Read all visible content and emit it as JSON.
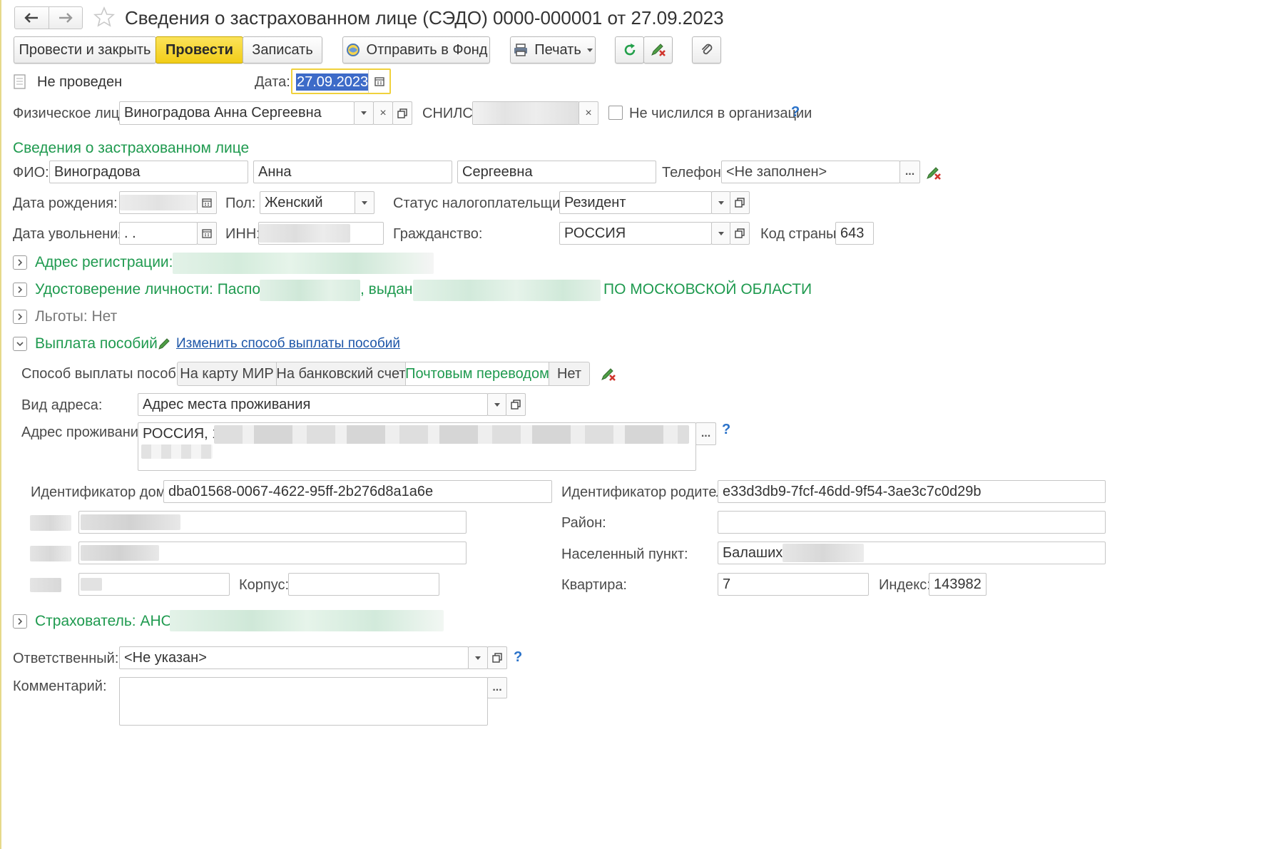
{
  "window": {
    "title": "Сведения о застрахованном лице (СЭДО) 0000-000001 от 27.09.2023"
  },
  "toolbar": {
    "post_and_close": "Провести и закрыть",
    "post": "Провести",
    "save": "Записать",
    "send_to_fund": "Отправить в Фонд",
    "print": "Печать"
  },
  "status": {
    "state": "Не проведен",
    "date_label": "Дата:",
    "date_value": "27.09.2023"
  },
  "person": {
    "label": "Физическое лицо:",
    "value": "Виноградова Анна Сергеевна",
    "snils_label": "СНИЛС:",
    "not_listed_label": "Не числился в организации",
    "help": "?"
  },
  "insured": {
    "section_title": "Сведения о застрахованном лице",
    "fio_label": "ФИО:",
    "last_name": "Виноградова",
    "first_name": "Анна",
    "middle_name": "Сергеевна",
    "phone_label": "Телефон:",
    "phone_value": "<Не заполнен>",
    "ellipsis": "...",
    "birth_label": "Дата рождения:",
    "sex_label": "Пол:",
    "sex_value": "Женский",
    "tax_status_label": "Статус налогоплательщика:",
    "tax_status_value": "Резидент",
    "dismissal_label": "Дата увольнения:",
    "dismissal_value": " .  .",
    "inn_label": "ИНН:",
    "citizenship_label": "Гражданство:",
    "citizenship_value": "РОССИЯ",
    "country_code_label": "Код страны:",
    "country_code_value": "643"
  },
  "groups": {
    "registration": "Адрес регистрации: Е",
    "identity_prefix": "Удостоверение личности: Паспорт",
    "identity_issued": ", выдан",
    "identity_suffix": "ПО МОСКОВСКОЙ ОБЛАСТИ",
    "benefits_privileges": "Льготы: Нет",
    "payment": "Выплата пособий",
    "change_payment_link": "Изменить способ выплаты пособий",
    "insurer": "Страхователь: АНО ("
  },
  "payment": {
    "method_label": "Способ выплаты пособий:",
    "methods": [
      "На карту МИР",
      "На банковский счет",
      "Почтовым переводом",
      "Нет"
    ],
    "address_kind_label": "Вид адреса:",
    "address_kind_value": "Адрес места проживания",
    "residence_label": "Адрес проживания:",
    "residence_value": "РОССИЯ, 1",
    "house_id_label": "Идентификатор дома:",
    "house_id_value": "dba01568-0067-4622-95ff-2b276d8a1a6e",
    "parent_id_label": "Идентификатор родителя:",
    "parent_id_value": "e33d3db9-7fcf-46dd-9f54-3ae3c7c0d29b",
    "district_label": "Район:",
    "locality_label": "Населенный пункт:",
    "locality_value": "Балашиха",
    "building_label": "Корпус:",
    "flat_label": "Квартира:",
    "flat_value": "7",
    "index_label": "Индекс:",
    "index_value": "143982"
  },
  "footer": {
    "responsible_label": "Ответственный:",
    "responsible_value": "<Не указан>",
    "comment_label": "Комментарий:"
  },
  "colors": {
    "accent_green": "#1f9a4f",
    "primary_yellow": "#f2cd18",
    "link_blue": "#1d56a8"
  }
}
